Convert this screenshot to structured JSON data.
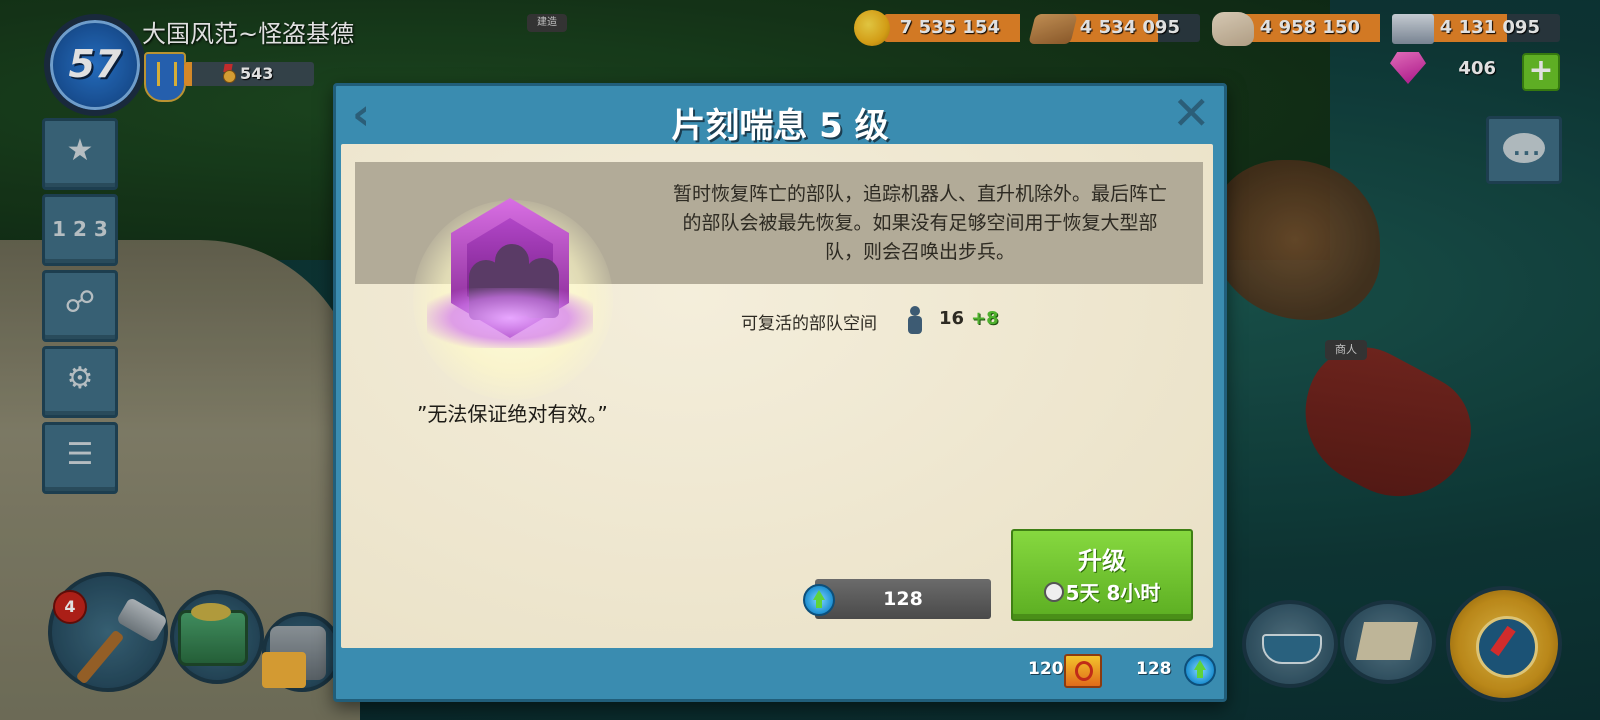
{
  "player": {
    "level": "57",
    "name": "大国风范~怪盗基德",
    "medals": "543",
    "xp_fraction": 0.06
  },
  "resources": {
    "gold": "7 535 154",
    "wood": "4 534 095",
    "stone": "4 958 150",
    "iron": "4 131 095",
    "gems": "406"
  },
  "map_labels": {
    "sign": "建造",
    "boat": "商人"
  },
  "dialog": {
    "title": "片刻喘息 5 级",
    "description": "暂时恢复阵亡的部队，追踪机器人、直升机除外。最后阵亡的部队会被最先恢复。如果没有足够空间用于恢复大型部队，则会召唤出步兵。",
    "stat_label": "可复活的部队空间",
    "stat_value": "16",
    "stat_bonus": "+8",
    "quote": "”无法保证绝对有效。”",
    "cost": "128",
    "upgrade_label": "升级",
    "upgrade_time": "5天 8小时",
    "footer_left": "120",
    "footer_right": "128"
  },
  "build_queue": "4",
  "colors": {
    "dialog_frame": "#3a8cb0",
    "panel": "#efe8d2",
    "upgrade_green": "#6cc72a",
    "bonus_green": "#4fb12e",
    "bar_orange": "#f08a2a"
  }
}
